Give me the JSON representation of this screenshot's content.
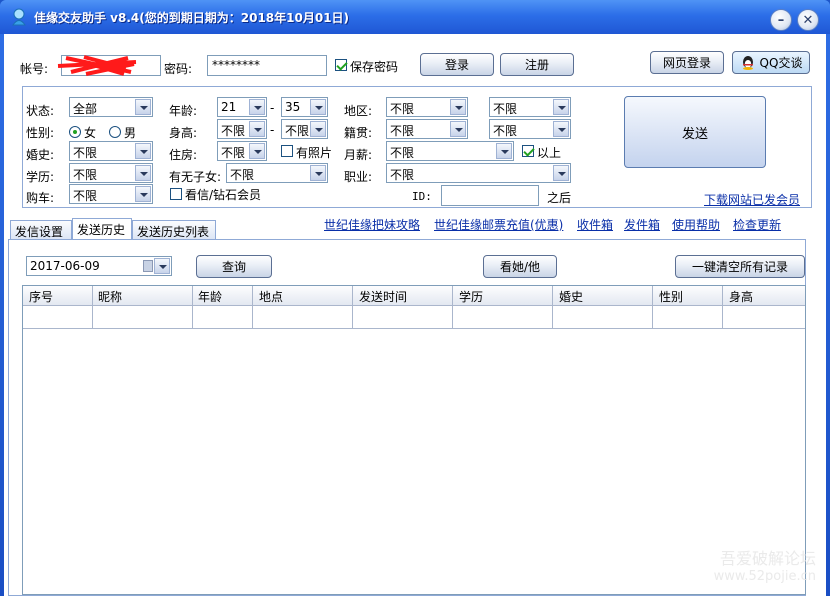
{
  "window": {
    "title": "佳缘交友助手 v8.4(您的到期日期为：2018年10月01日)"
  },
  "login": {
    "account_label": "帐号:",
    "account_value": "",
    "password_label": "密码:",
    "password_value": "********",
    "save_password_label": "保存密码",
    "login_button": "登录",
    "register_button": "注册",
    "web_login_button": "网页登录",
    "qq_chat_button": "QQ交谈"
  },
  "filters": {
    "status_label": "状态:",
    "status_value": "全部",
    "gender_label": "性别:",
    "gender_female": "女",
    "gender_male": "男",
    "marriage_label": "婚史:",
    "marriage_value": "不限",
    "education_label": "学历:",
    "education_value": "不限",
    "car_label": "购车:",
    "car_value": "不限",
    "age_label": "年龄:",
    "age_from": "21",
    "age_to": "35",
    "age_sep": "-",
    "height_label": "身高:",
    "height_from": "不限",
    "height_to": "不限",
    "height_sep": "-",
    "housing_label": "住房:",
    "housing_value": "不限",
    "with_photo_label": "有照片",
    "children_label": "有无子女:",
    "children_value": "不限",
    "member_label": "看信/钻石会员",
    "region_label": "地区:",
    "region_value1": "不限",
    "region_value2": "不限",
    "native_label": "籍贯:",
    "native_value1": "不限",
    "native_value2": "不限",
    "salary_label": "月薪:",
    "salary_value": "不限",
    "above_label": "以上",
    "job_label": "职业:",
    "job_value": "不限",
    "id_label": "ID:",
    "id_value": "",
    "after_label": "之后",
    "send_button": "发送",
    "download_link": "下载网站已发会员"
  },
  "tabs": [
    {
      "label": "发信设置"
    },
    {
      "label": "发送历史"
    },
    {
      "label": "发送历史列表"
    }
  ],
  "links": [
    "世纪佳缘把妹攻略",
    "世纪佳缘邮票充值(优惠)",
    "收件箱",
    "发件箱",
    "使用帮助",
    "检查更新"
  ],
  "history": {
    "date_value": "2017-06-09",
    "query_button": "查询",
    "view_button": "看她/他",
    "clear_button": "一键清空所有记录",
    "columns": [
      "序号",
      "昵称",
      "年龄",
      "地点",
      "发送时间",
      "学历",
      "婚史",
      "性别",
      "身高"
    ]
  },
  "watermark": {
    "line1": "吾爱破解论坛",
    "line2": "www.52pojie.cn"
  }
}
